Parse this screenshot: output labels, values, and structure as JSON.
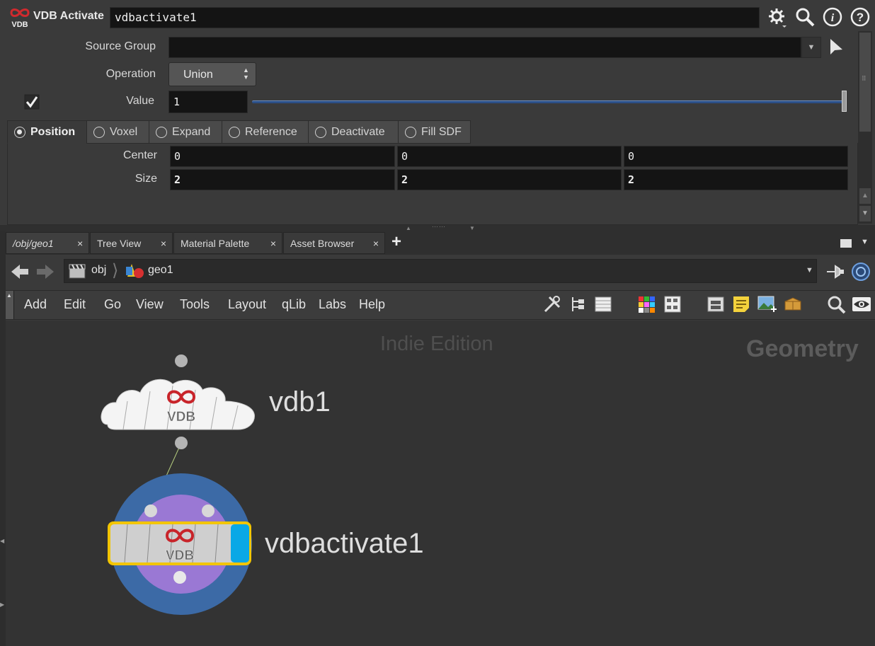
{
  "header": {
    "node_type": "VDB Activate",
    "node_name": "vdbactivate1"
  },
  "params": {
    "source_group_label": "Source Group",
    "source_group_value": "",
    "operation_label": "Operation",
    "operation_value": "Union",
    "value_label": "Value",
    "value_value": "1",
    "value_slider_fraction": 1.0
  },
  "tabs": [
    {
      "label": "Position",
      "selected": true
    },
    {
      "label": "Voxel",
      "selected": false
    },
    {
      "label": "Expand",
      "selected": false
    },
    {
      "label": "Reference",
      "selected": false
    },
    {
      "label": "Deactivate",
      "selected": false
    },
    {
      "label": "Fill SDF",
      "selected": false
    }
  ],
  "position": {
    "center_label": "Center",
    "center": [
      "0",
      "0",
      "0"
    ],
    "size_label": "Size",
    "size": [
      "2",
      "2",
      "2"
    ]
  },
  "pane_tabs": [
    {
      "label": "/obj/geo1"
    },
    {
      "label": "Tree View"
    },
    {
      "label": "Material Palette"
    },
    {
      "label": "Asset Browser"
    }
  ],
  "close_glyph": "×",
  "add_tab_glyph": "+",
  "path": {
    "seg1": "obj",
    "seg2": "geo1"
  },
  "menu": [
    "Add",
    "Edit",
    "Go",
    "View",
    "Tools",
    "Layout",
    "qLib",
    "Labs",
    "Help"
  ],
  "network": {
    "watermark_edition": "Indie Edition",
    "watermark_context": "Geometry",
    "nodes": [
      {
        "name": "vdb1",
        "icon_text": "VDB"
      },
      {
        "name": "vdbactivate1",
        "icon_text": "VDB"
      }
    ]
  },
  "logo_text": "VDB",
  "colors": {
    "accent_blue": "#0aa8e6",
    "selected_outline": "#f2c500",
    "node_ring_outer": "#3b6aa8",
    "node_ring_inner": "#9a78d4",
    "vdb_red": "#c8242a"
  },
  "icons": [
    "gear-icon",
    "search-icon",
    "info-icon",
    "help-icon",
    "pointer-icon",
    "back-arrow-icon",
    "forward-arrow-icon",
    "pin-icon",
    "network-icon"
  ]
}
